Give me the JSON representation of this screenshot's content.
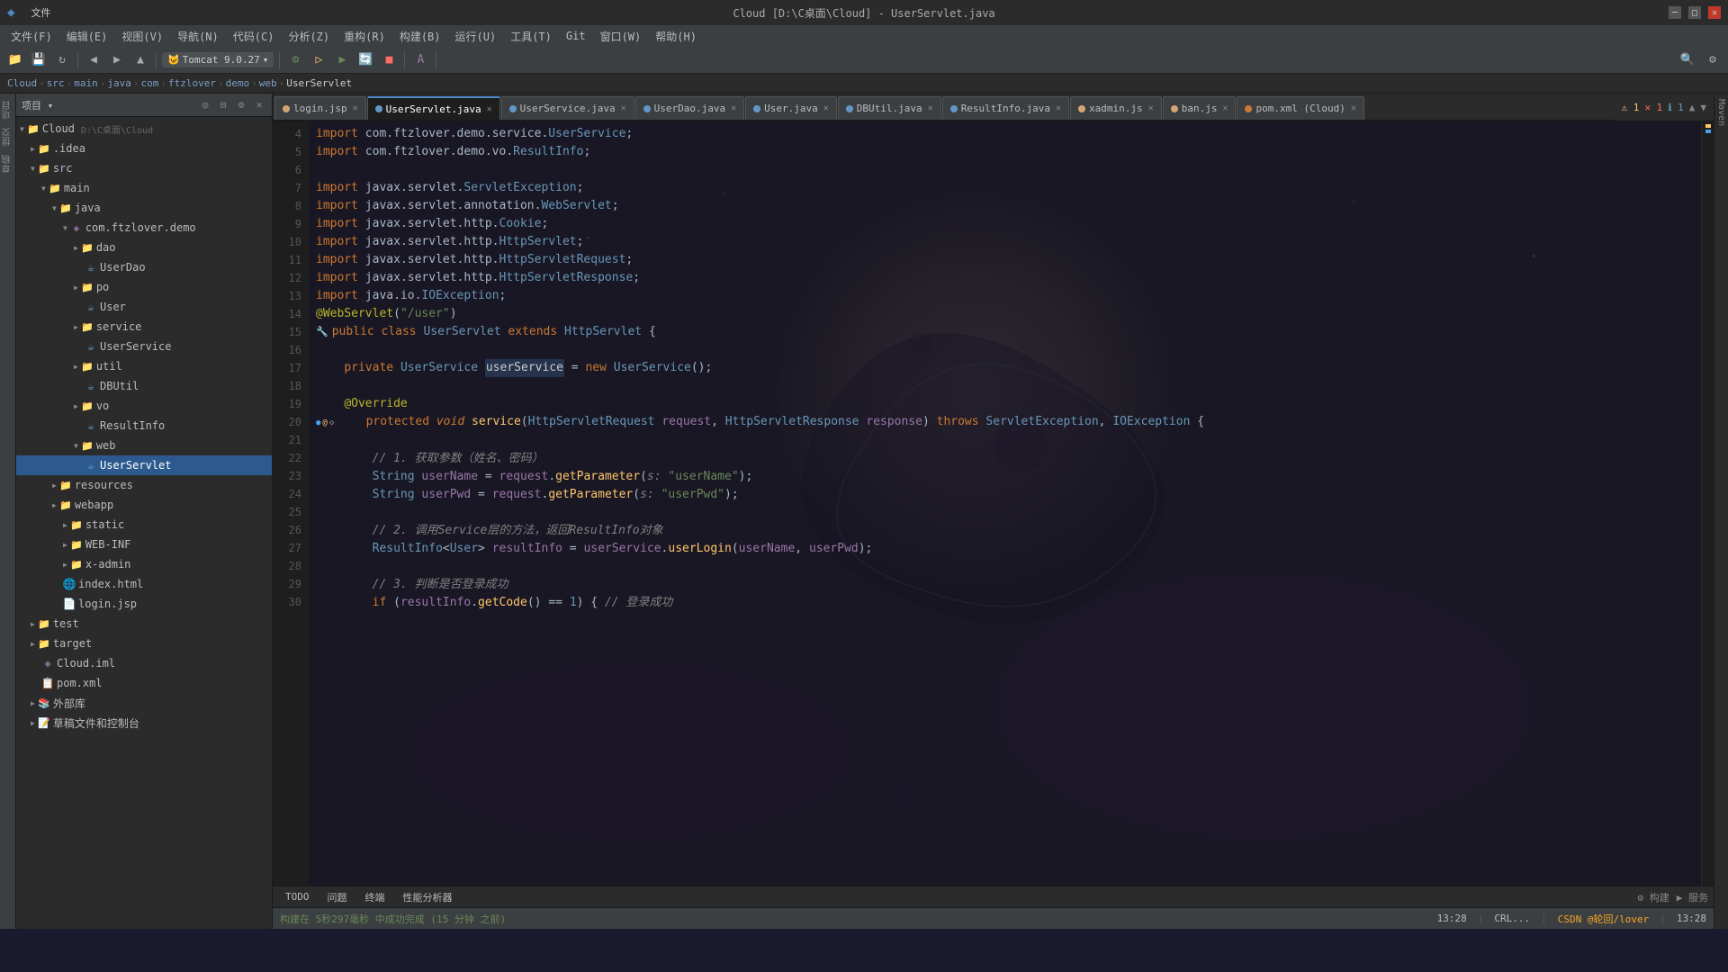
{
  "titlebar": {
    "title": "Cloud [D:\\C桌面\\Cloud] - UserServlet.java",
    "minimize": "─",
    "maximize": "□",
    "close": "✕"
  },
  "menubar": {
    "items": [
      "文件(F)",
      "编辑(E)",
      "视图(V)",
      "导航(N)",
      "代码(C)",
      "分析(Z)",
      "重构(R)",
      "构建(B)",
      "运行(U)",
      "工具(T)",
      "Git",
      "窗口(W)",
      "帮助(H)"
    ]
  },
  "toolbar": {
    "tomcat": "Tomcat 9.0.27",
    "translate_label": "A"
  },
  "breadcrumb": {
    "items": [
      "Cloud",
      "src",
      "main",
      "java",
      "com",
      "ftzlover",
      "demo",
      "web",
      "UserServlet"
    ]
  },
  "tabs": [
    {
      "name": "login.jsp",
      "dot_color": "#d4a574",
      "active": false
    },
    {
      "name": "UserServlet.java",
      "dot_color": "#6197c7",
      "active": true
    },
    {
      "name": "UserService.java",
      "dot_color": "#6197c7",
      "active": false
    },
    {
      "name": "UserDao.java",
      "dot_color": "#6197c7",
      "active": false
    },
    {
      "name": "User.java",
      "dot_color": "#6197c7",
      "active": false
    },
    {
      "name": "DBUtil.java",
      "dot_color": "#6197c7",
      "active": false
    },
    {
      "name": "ResultInfo.java",
      "dot_color": "#6197c7",
      "active": false
    },
    {
      "name": "xadmin.js",
      "dot_color": "#d4a574",
      "active": false
    },
    {
      "name": "ban.js",
      "dot_color": "#d4a574",
      "active": false
    },
    {
      "name": "pom.xml (Cloud)",
      "dot_color": "#cc7832",
      "active": false
    }
  ],
  "warnings": {
    "warn_icon": "⚠",
    "warn_count": "1",
    "err_icon": "✕",
    "err_count": "1",
    "info_icon": "ℹ",
    "info_count": "1",
    "up": "▲",
    "down": "▼"
  },
  "file_tree": {
    "project_label": "项目 ▾",
    "root": {
      "name": "Cloud",
      "path": "D:\\C桌面\\Cloud",
      "children": [
        {
          "name": ".idea",
          "type": "folder",
          "indent": 1,
          "expanded": false
        },
        {
          "name": "src",
          "type": "folder",
          "indent": 1,
          "expanded": true,
          "children": [
            {
              "name": "main",
              "type": "folder",
              "indent": 2,
              "expanded": true,
              "children": [
                {
                  "name": "java",
                  "type": "folder",
                  "indent": 3,
                  "expanded": true,
                  "children": [
                    {
                      "name": "com.ftzlover.demo",
                      "type": "folder",
                      "indent": 4,
                      "expanded": true,
                      "children": [
                        {
                          "name": "dao",
                          "type": "folder",
                          "indent": 5,
                          "expanded": false,
                          "children": [
                            {
                              "name": "UserDao",
                              "type": "java",
                              "indent": 6
                            }
                          ]
                        },
                        {
                          "name": "po",
                          "type": "folder",
                          "indent": 5,
                          "expanded": false,
                          "children": [
                            {
                              "name": "User",
                              "type": "java",
                              "indent": 6
                            }
                          ]
                        },
                        {
                          "name": "service",
                          "type": "folder",
                          "indent": 5,
                          "expanded": false,
                          "children": [
                            {
                              "name": "UserService",
                              "type": "java",
                              "indent": 6
                            }
                          ]
                        },
                        {
                          "name": "util",
                          "type": "folder",
                          "indent": 5,
                          "expanded": false,
                          "children": [
                            {
                              "name": "DBUtil",
                              "type": "java",
                              "indent": 6
                            }
                          ]
                        },
                        {
                          "name": "vo",
                          "type": "folder",
                          "indent": 5,
                          "expanded": false,
                          "children": [
                            {
                              "name": "ResultInfo",
                              "type": "java",
                              "indent": 6
                            }
                          ]
                        },
                        {
                          "name": "web",
                          "type": "folder",
                          "indent": 5,
                          "expanded": true,
                          "children": [
                            {
                              "name": "UserServlet",
                              "type": "java",
                              "indent": 6,
                              "selected": true
                            }
                          ]
                        }
                      ]
                    }
                  ]
                },
                {
                  "name": "resources",
                  "type": "folder",
                  "indent": 3,
                  "expanded": false
                },
                {
                  "name": "webapp",
                  "type": "folder",
                  "indent": 3,
                  "expanded": false,
                  "children": [
                    {
                      "name": "static",
                      "type": "folder",
                      "indent": 4
                    },
                    {
                      "name": "WEB-INF",
                      "type": "folder",
                      "indent": 4
                    },
                    {
                      "name": "x-admin",
                      "type": "folder",
                      "indent": 4
                    },
                    {
                      "name": "index.html",
                      "type": "html",
                      "indent": 4
                    },
                    {
                      "name": "login.jsp",
                      "type": "jsp",
                      "indent": 4
                    }
                  ]
                }
              ]
            }
          ]
        },
        {
          "name": "test",
          "type": "folder",
          "indent": 1,
          "expanded": false
        },
        {
          "name": "target",
          "type": "folder",
          "indent": 1,
          "expanded": false,
          "children": [
            {
              "name": "Cloud.iml",
              "type": "iml",
              "indent": 2
            },
            {
              "name": "pom.xml",
              "type": "xml",
              "indent": 2
            }
          ]
        },
        {
          "name": "外部库",
          "type": "folder",
          "indent": 1
        },
        {
          "name": "草稿文件和控制台",
          "type": "folder",
          "indent": 1
        }
      ]
    }
  },
  "code_lines": [
    {
      "num": 4,
      "content": "import com.ftzlover.demo.service.UserService;"
    },
    {
      "num": 5,
      "content": "import com.ftzlover.demo.vo.ResultInfo;"
    },
    {
      "num": 6,
      "content": ""
    },
    {
      "num": 7,
      "content": "import javax.servlet.ServletException;"
    },
    {
      "num": 8,
      "content": "import javax.servlet.annotation.WebServlet;"
    },
    {
      "num": 9,
      "content": "import javax.servlet.http.Cookie;"
    },
    {
      "num": 10,
      "content": "import javax.servlet.http.HttpServlet;"
    },
    {
      "num": 11,
      "content": "import javax.servlet.http.HttpServletRequest;"
    },
    {
      "num": 12,
      "content": "import javax.servlet.http.HttpServletResponse;"
    },
    {
      "num": 13,
      "content": "import java.io.IOException;"
    },
    {
      "num": 14,
      "content": "@WebServlet(\"/user\")"
    },
    {
      "num": 15,
      "content": "public class UserServlet extends HttpServlet {"
    },
    {
      "num": 16,
      "content": ""
    },
    {
      "num": 17,
      "content": "    private UserService userService = new UserService();"
    },
    {
      "num": 18,
      "content": ""
    },
    {
      "num": 19,
      "content": "    @Override"
    },
    {
      "num": 20,
      "content": "    protected void service(HttpServletRequest request, HttpServletResponse response) throws ServletException, IOException {",
      "has_gutter": true
    },
    {
      "num": 21,
      "content": ""
    },
    {
      "num": 22,
      "content": "        // 1. 获取参数（姓名、密码）"
    },
    {
      "num": 23,
      "content": "        String userName = request.getParameter(s: \"userName\");"
    },
    {
      "num": 24,
      "content": "        String userPwd = request.getParameter(s: \"userPwd\");"
    },
    {
      "num": 25,
      "content": ""
    },
    {
      "num": 26,
      "content": "        // 2. 调用Service层的方法，返回ResultInfo对象"
    },
    {
      "num": 27,
      "content": "        ResultInfo<User> resultInfo = userService.userLogin(userName, userPwd);"
    },
    {
      "num": 28,
      "content": ""
    },
    {
      "num": 29,
      "content": "        // 3. 判断是否登录成功"
    },
    {
      "num": 30,
      "content": "        if (resultInfo.getCode() == 1) { // 登录成功"
    }
  ],
  "statusbar": {
    "build": "构建",
    "service": "服务",
    "build_label": "构建",
    "service_label": "服务",
    "todo": "TODO",
    "problems": "问题",
    "terminal": "终端",
    "profiler": "性能分析器",
    "build_status": "构建在 5秒297毫秒 中成功完成 (15 分钟 之前)",
    "line_col": "13:28",
    "encoding": "CRL...",
    "csdn_info": "CSDN @轮回/lover",
    "time": "13:28"
  },
  "bottom_tabs": [
    "TODO",
    "问题",
    "终端",
    "性能分析器"
  ],
  "right_panel_labels": [
    "Maven"
  ]
}
